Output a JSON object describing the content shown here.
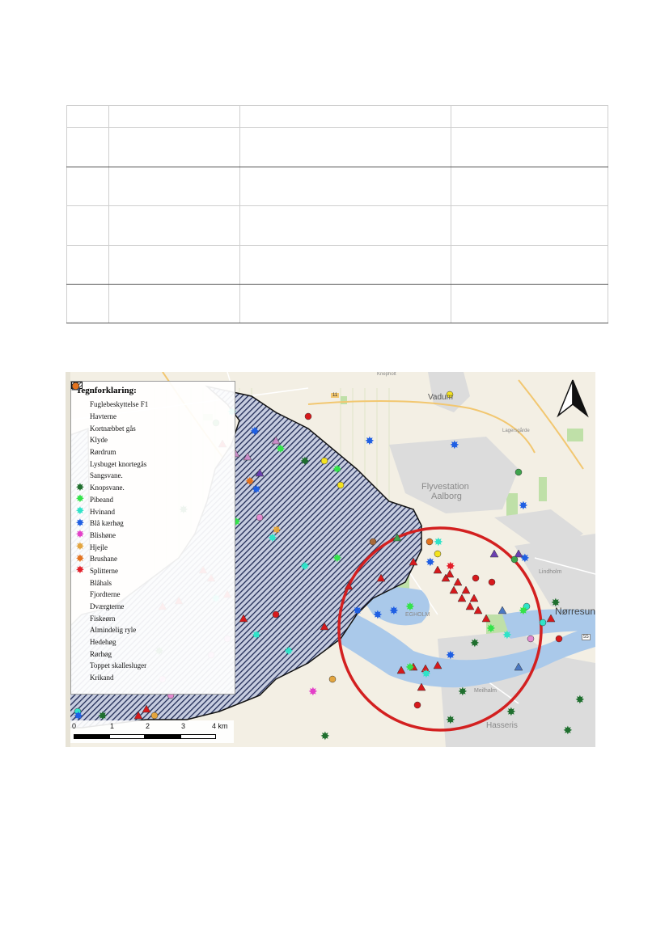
{
  "map": {
    "legend_title": "Tegnforklaring:",
    "legend": [
      {
        "label": "Fuglebeskyttelse F1",
        "symbol": "hatch",
        "color": "#1f2a55"
      },
      {
        "label": "Havterne",
        "symbol": "triangle",
        "color": "#6a3fb0"
      },
      {
        "label": "Kortnæbbet gås",
        "symbol": "triangle",
        "color": "#c98bc8"
      },
      {
        "label": "Klyde",
        "symbol": "triangle",
        "color": "#b08a6a"
      },
      {
        "label": "Rørdrum",
        "symbol": "triangle",
        "color": "#3fa34d"
      },
      {
        "label": "Lysbuget knortegås",
        "symbol": "triangle",
        "color": "#d7191c"
      },
      {
        "label": "Sangsvane.",
        "symbol": "triangle",
        "color": "#4a78c2"
      },
      {
        "label": "Knopsvane.",
        "symbol": "star",
        "color": "#1f6f2e"
      },
      {
        "label": "Pibeand",
        "symbol": "star",
        "color": "#33e34a"
      },
      {
        "label": "Hvinand",
        "symbol": "star",
        "color": "#2fe3c8"
      },
      {
        "label": "Blå kærhøg",
        "symbol": "star",
        "color": "#1f5fe3"
      },
      {
        "label": "Blishøne",
        "symbol": "star",
        "color": "#e33fc8"
      },
      {
        "label": "Hjejle",
        "symbol": "star",
        "color": "#e3a53f"
      },
      {
        "label": "Brushane",
        "symbol": "star",
        "color": "#e3731f"
      },
      {
        "label": "Splitterne",
        "symbol": "star",
        "color": "#e31f2a"
      },
      {
        "label": "Blåhals",
        "symbol": "circle",
        "color": "#c8202a"
      },
      {
        "label": "Fjordterne",
        "symbol": "circle",
        "color": "#2f6f2a"
      },
      {
        "label": "Dværgterne",
        "symbol": "circle",
        "color": "#3fd0d0"
      },
      {
        "label": "Fiskeørn",
        "symbol": "circle",
        "color": "#f5e31f"
      },
      {
        "label": "Almindelig ryle",
        "symbol": "circle",
        "color": "#a86a3a"
      },
      {
        "label": "Hedehøg",
        "symbol": "circle",
        "color": "#3a6aa8"
      },
      {
        "label": "Rørhøg",
        "symbol": "circle",
        "color": "#3fa34d"
      },
      {
        "label": "Toppet skallesluger",
        "symbol": "circle",
        "color": "#e38ad0"
      },
      {
        "label": "Krikand",
        "symbol": "circle",
        "color": "#e3731f"
      }
    ],
    "scale_labels": [
      "0",
      "1",
      "2",
      "3",
      "4 km"
    ],
    "place_labels": {
      "vadum": "Vadum",
      "flyvestation": "Flyvestation",
      "aalborg": "Aalborg",
      "egholm": "EGHOLM",
      "norresundby": "Nørresun",
      "lindholm": "Lindholm",
      "meilhalm": "Meilhalm",
      "hasseris": "Hasseris",
      "knepholt": "Knepholt",
      "lagersgaarde": "Lagersgårde",
      "road11": "11",
      "road55": "55"
    }
  }
}
